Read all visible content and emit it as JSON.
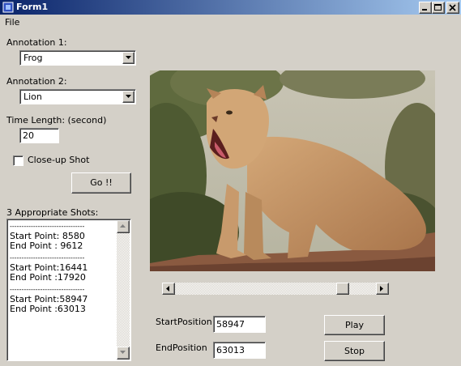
{
  "window": {
    "title": "Form1",
    "controls": [
      "minimize-icon",
      "maximize-icon",
      "close-icon"
    ]
  },
  "menu": {
    "file": "File"
  },
  "annotation1": {
    "label": "Annotation 1:",
    "value": "Frog"
  },
  "annotation2": {
    "label": "Annotation 2:",
    "value": "Lion"
  },
  "time_length": {
    "label": "Time Length: (second)",
    "value": "20"
  },
  "closeup": {
    "label": "Close-up Shot",
    "checked": false
  },
  "go_button": "Go !!",
  "shots": {
    "label": "3 Appropriate Shots:",
    "lines": [
      "--------------------------------",
      "Start Point: 8580",
      "End Point : 9612",
      "--------------------------------",
      "Start Point:16441",
      "End Point :17920",
      "--------------------------------",
      "Start Point:58947",
      "End Point :63013"
    ]
  },
  "video": {
    "content": "lion-video-frame",
    "position_fraction": 0.82
  },
  "start_position": {
    "label": "StartPosition",
    "value": "58947"
  },
  "end_position": {
    "label": "EndPosition",
    "value": "63013"
  },
  "play_button": "Play",
  "stop_button": "Stop",
  "colors": {
    "face": "#d4d0c8",
    "titlebar_start": "#0a246a",
    "titlebar_end": "#a6caf0"
  }
}
